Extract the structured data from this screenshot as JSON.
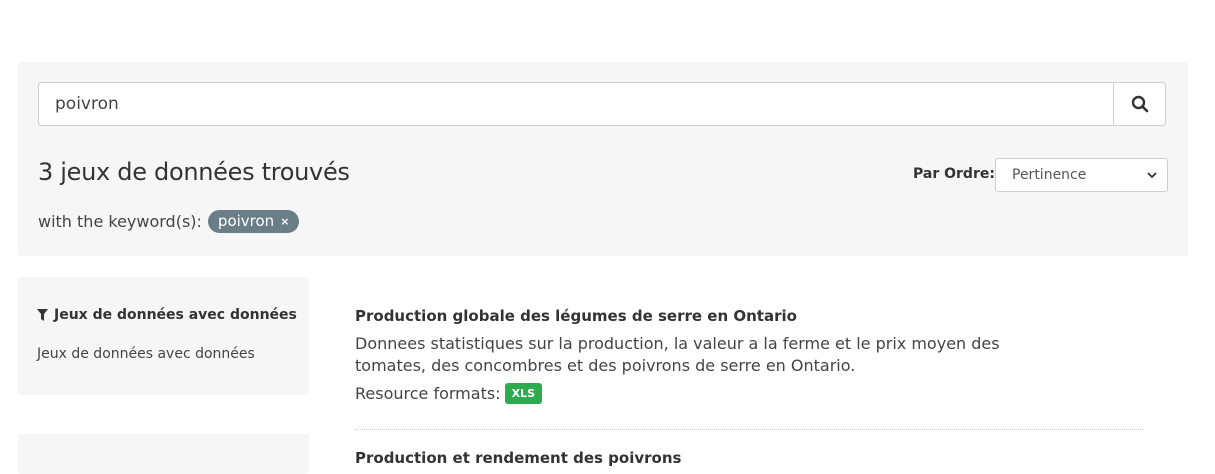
{
  "search": {
    "value": "poivron",
    "button_icon": "search-icon"
  },
  "results": {
    "title": "3 jeux de données trouvés",
    "sort_label": "Par Ordre:",
    "sort_value": "Pertinence",
    "keyword_prefix": "with the keyword(s):",
    "keyword": "poivron",
    "keyword_remove": "×"
  },
  "facets": {
    "title": "Jeux de données avec données",
    "items": [
      "Jeux de données avec données"
    ]
  },
  "datasets": [
    {
      "title": "Production globale des légumes de serre en Ontario",
      "description": "Donnees statistiques sur la production, la valeur a la ferme et le prix moyen des tomates, des concombres et des poivrons de serre en Ontario.",
      "formats_label": "Resource formats:",
      "formats": [
        "XLS"
      ]
    },
    {
      "title": "Production et rendement des poivrons"
    }
  ],
  "colors": {
    "panel_bg": "#f6f6f6",
    "pill_bg": "#6a7e87",
    "badge_xls": "#2eab4f"
  }
}
